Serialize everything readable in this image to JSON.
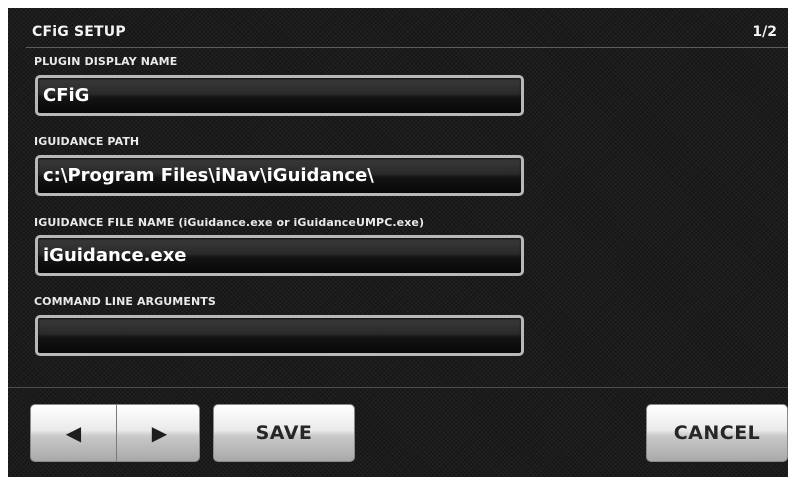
{
  "header": {
    "title": "CFiG SETUP",
    "page": "1/2"
  },
  "fields": [
    {
      "label": "PLUGIN DISPLAY NAME",
      "value": "CFiG"
    },
    {
      "label": "IGUIDANCE PATH",
      "value": "c:\\Program Files\\iNav\\iGuidance\\"
    },
    {
      "label": "IGUIDANCE FILE NAME (iGuidance.exe or iGuidanceUMPC.exe)",
      "value": "iGuidance.exe"
    },
    {
      "label": "COMMAND LINE ARGUMENTS",
      "value": ""
    }
  ],
  "buttons": {
    "prev_icon": "◀",
    "next_icon": "▶",
    "save": "SAVE",
    "cancel": "CANCEL"
  },
  "icons": {
    "prev": "left-triangle-arrow",
    "next": "right-triangle-arrow"
  },
  "colors": {
    "background": "#1b1b1b",
    "field_border": "#b8b8b8",
    "button_face": "#d8d8d8",
    "text": "#f4f4f4"
  }
}
